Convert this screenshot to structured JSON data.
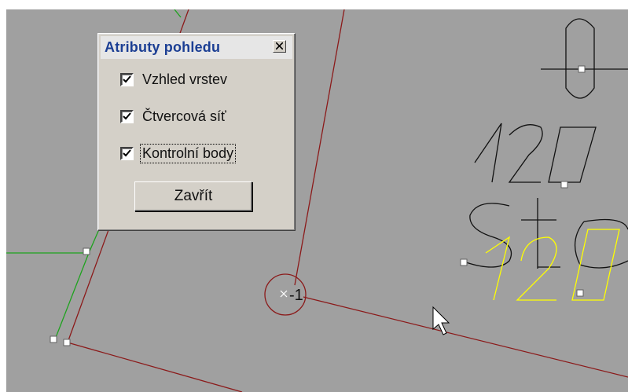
{
  "dialog": {
    "title": "Atributy pohledu",
    "checkboxes": [
      {
        "label": "Vzhled vrstev",
        "checked": true
      },
      {
        "label": "Čtvercová síť",
        "checked": true
      },
      {
        "label": "Kontrolní body",
        "checked": true
      }
    ],
    "close_button_label": "Zavřít"
  },
  "drawing": {
    "point_label": "-1",
    "text_black": "120",
    "text_black_line2": "sto",
    "text_yellow": "120",
    "colors": {
      "background": "#a0a0a0",
      "red_line": "#8b1a1a",
      "green_line": "#1ea21e",
      "yellow_text": "#ffff00",
      "black_text": "#111111"
    }
  },
  "icons": {
    "close": "close-x-icon",
    "check": "check-icon",
    "cursor": "mouse-pointer-icon"
  }
}
